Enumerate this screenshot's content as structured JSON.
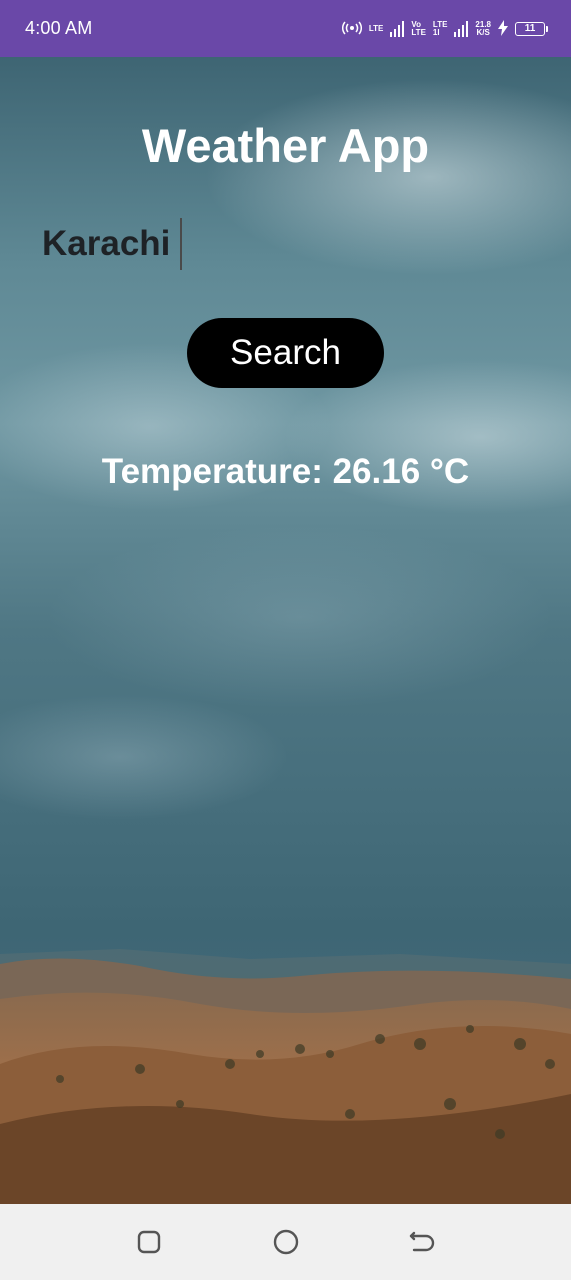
{
  "status_bar": {
    "time": "4:00 AM",
    "sim1_label_top": "LTE",
    "sim2_label_top": "Vo",
    "sim2_label_bottom": "LTE",
    "sim3_label_top": "LTE",
    "sim3_label_bottom": "1l",
    "speed_value": "21.8",
    "speed_unit": "K/S",
    "battery_level": "11",
    "bar_color": "#6a48a8"
  },
  "app": {
    "title": "Weather App",
    "city_input_value": "Karachi",
    "search_label": "Search",
    "temperature_text": "Temperature: 26.16 °C"
  },
  "nav_bar": {
    "recents_icon": "square-recents-icon",
    "home_icon": "circle-home-icon",
    "back_icon": "back-arrow-icon"
  }
}
